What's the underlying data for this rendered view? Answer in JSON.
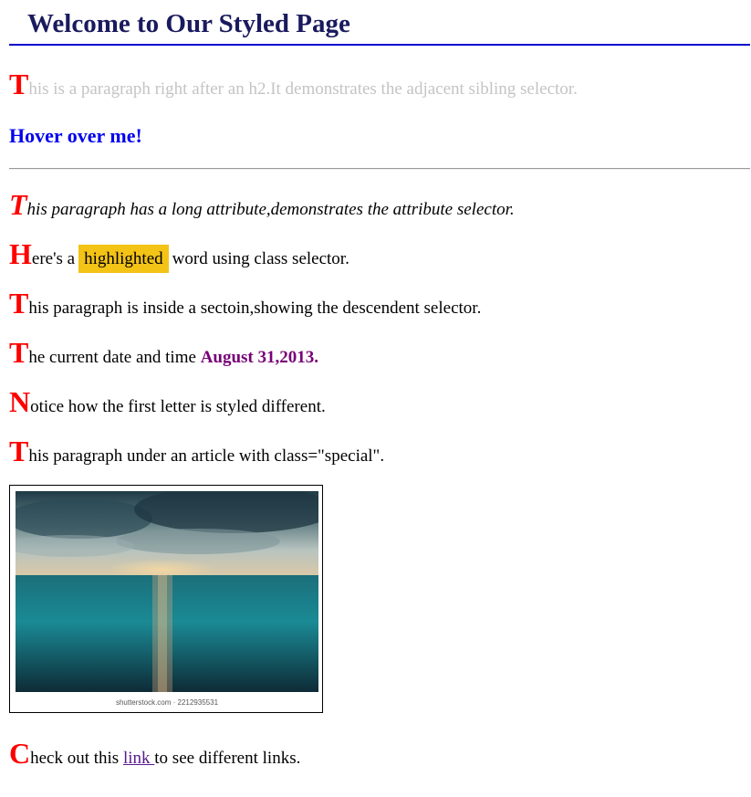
{
  "header": {
    "title": "Welcome to Our Styled Page"
  },
  "paragraphs": {
    "sibling": {
      "drop": "T",
      "rest": "his is a paragraph right after an h2.It demonstrates the adjacent sibling selector."
    },
    "hover": "Hover over me!",
    "attribute": {
      "drop": "T",
      "rest": "his paragraph has a long attribute,demonstrates the attribute selector."
    },
    "highlight": {
      "drop": "H",
      "before": "ere's a",
      "word": "highlighted",
      "after": "word using class selector."
    },
    "descendant": {
      "drop": "T",
      "rest": "his paragraph is inside a sectoin,showing the descendent selector."
    },
    "date": {
      "drop": "T",
      "rest": "he current date and time ",
      "value": "August 31,2013."
    },
    "notice": {
      "drop": "N",
      "rest": "otice how the first letter is styled different."
    },
    "special": {
      "drop": "T",
      "rest": "his paragraph under an article with class=\"special\"."
    },
    "link": {
      "drop": "C",
      "before": "heck out this ",
      "link_text": "link ",
      "after": "to see different links."
    }
  },
  "image": {
    "watermark": "shutterstock.com · 2212935531"
  },
  "colors": {
    "heading": "#1a1a5e",
    "heading_border": "#0000cc",
    "drop_cap": "#ff0000",
    "sibling_text": "#c4c4c4",
    "hover_text": "#0000ee",
    "highlight_bg": "#f3c316",
    "date_text": "#770077",
    "link": "#551a8b"
  }
}
